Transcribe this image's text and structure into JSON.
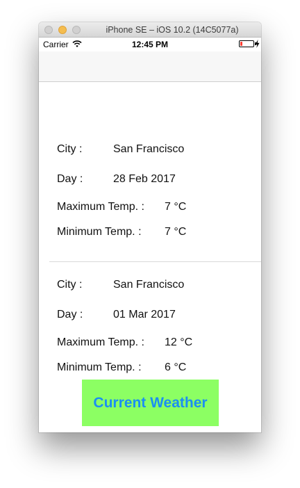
{
  "window": {
    "title": "iPhone SE – iOS 10.2 (14C5077a)"
  },
  "status_bar": {
    "carrier": "Carrier",
    "time": "12:45 PM",
    "icons": [
      "wifi-icon",
      "battery-icon",
      "charging-icon"
    ]
  },
  "forecast": [
    {
      "city_label": "City :",
      "city": "San Francisco",
      "day_label": "Day :",
      "day": "28 Feb 2017",
      "max_label": "Maximum Temp. :",
      "max": "7 °C",
      "min_label": "Minimum Temp. :",
      "min": "7 °C"
    },
    {
      "city_label": "City :",
      "city": "San Francisco",
      "day_label": "Day :",
      "day": "01 Mar 2017",
      "max_label": "Maximum Temp. :",
      "max": "12 °C",
      "min_label": "Minimum Temp. :",
      "min": "6 °C"
    }
  ],
  "button": {
    "label": "Current Weather"
  },
  "colors": {
    "button_background": "#8cff63",
    "button_text": "#1b8ef2",
    "battery_low": "#ff3b30"
  }
}
